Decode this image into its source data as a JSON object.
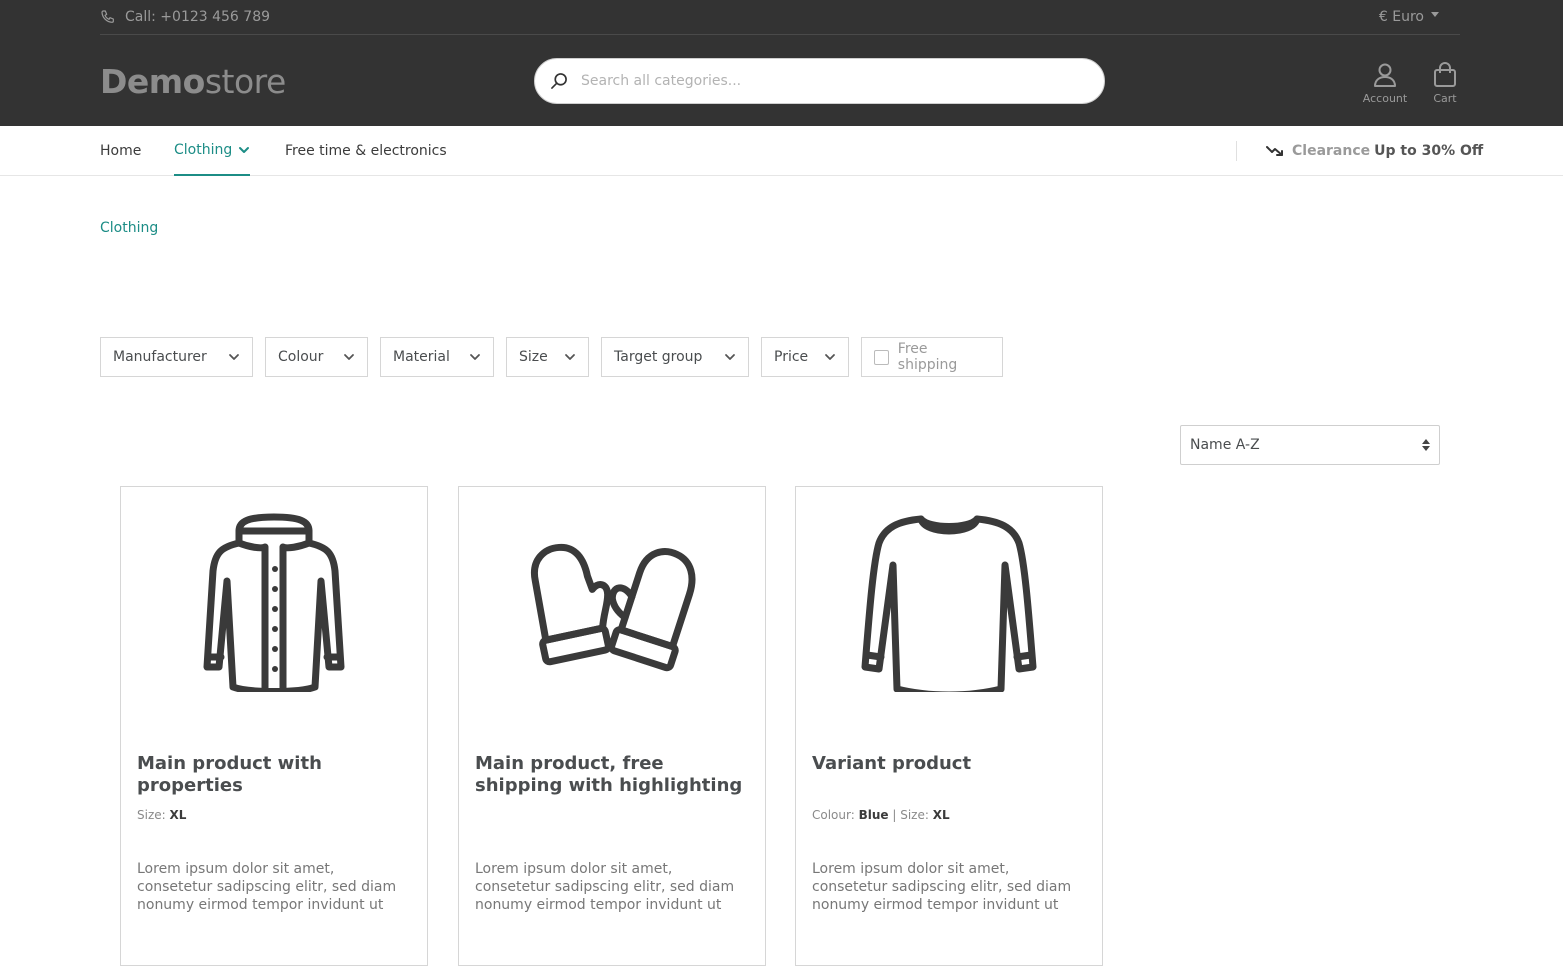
{
  "header": {
    "phone_label": "Call: +0123 456 789",
    "currency": "€ Euro",
    "logo_bold": "Demo",
    "logo_light": "store",
    "search_placeholder": "Search all categories...",
    "account_label": "Account",
    "cart_label": "Cart"
  },
  "nav": {
    "items": [
      {
        "label": "Home"
      },
      {
        "label": "Clothing"
      },
      {
        "label": "Free time & electronics"
      }
    ],
    "promo_title": "Clearance",
    "promo_text": "Up to 30% Off"
  },
  "breadcrumb": "Clothing",
  "filters": [
    {
      "label": "Manufacturer"
    },
    {
      "label": "Colour"
    },
    {
      "label": "Material"
    },
    {
      "label": "Size"
    },
    {
      "label": "Target group"
    },
    {
      "label": "Price"
    },
    {
      "label": "Free shipping"
    }
  ],
  "sort": {
    "selected": "Name A-Z"
  },
  "products": [
    {
      "title": "Main product with properties",
      "prop1_label": "Size:",
      "prop1_value": "XL",
      "description": "Lorem ipsum dolor sit amet, consetetur sadipscing elitr, sed diam nonumy eirmod tempor invidunt ut labore et...",
      "icon": "jacket-icon"
    },
    {
      "title": "Main product, free shipping with highlighting",
      "description": "Lorem ipsum dolor sit amet, consetetur sadipscing elitr, sed diam nonumy eirmod tempor invidunt ut labore et...",
      "icon": "mittens-icon"
    },
    {
      "title": "Variant product",
      "prop1_label": "Colour:",
      "prop1_value": "Blue",
      "prop_sep": " | ",
      "prop2_label": "Size:",
      "prop2_value": "XL",
      "description": "Lorem ipsum dolor sit amet, consetetur sadipscing elitr, sed diam nonumy eirmod tempor invidunt ut labore et...",
      "icon": "sweater-icon"
    }
  ],
  "colors": {
    "header_bg": "#333333",
    "accent": "#1c8d86",
    "icon": "#3a3a3a"
  }
}
